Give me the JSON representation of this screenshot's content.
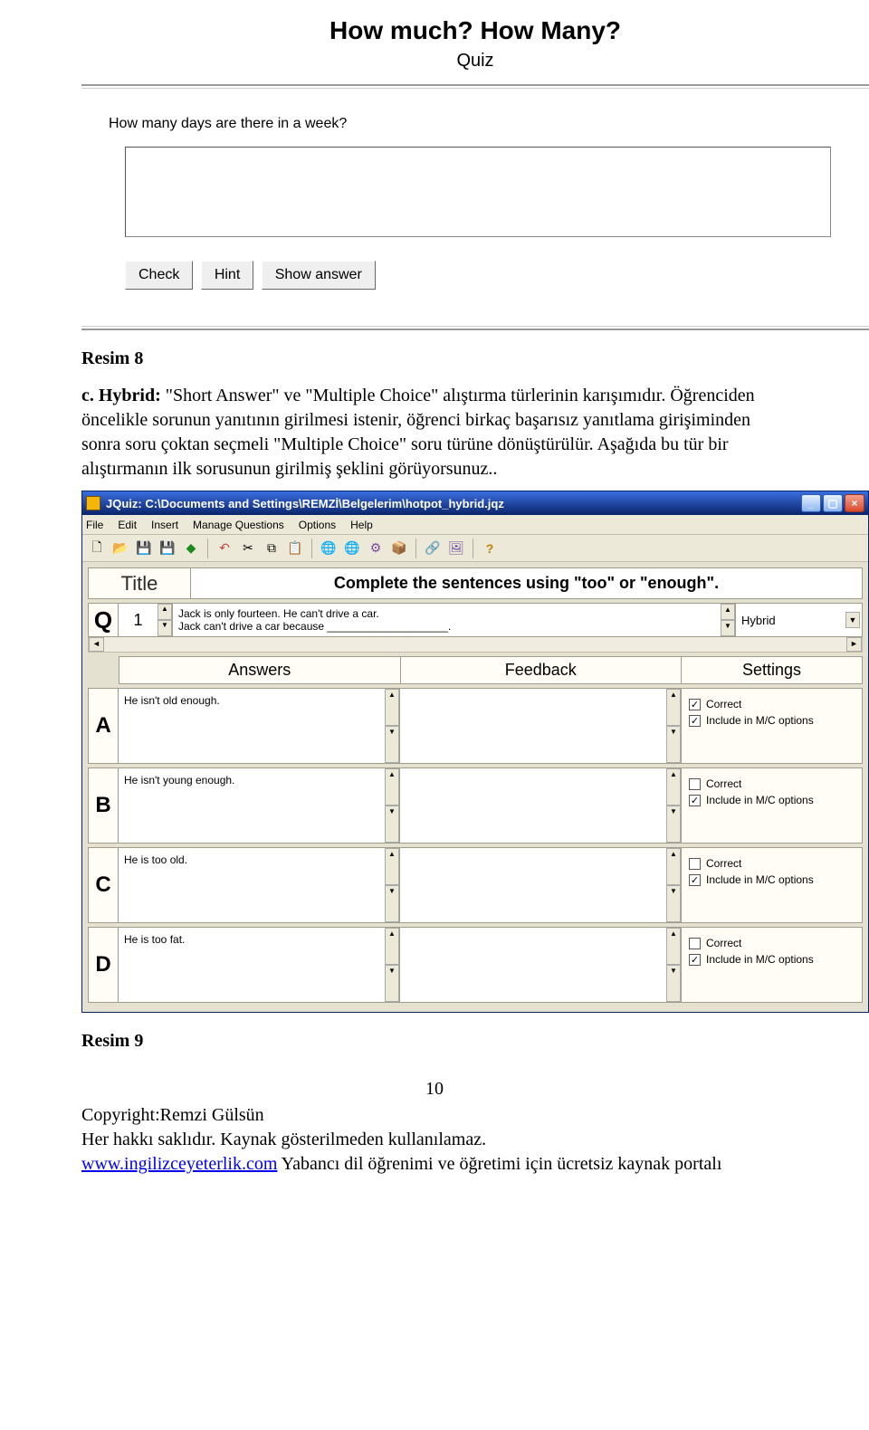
{
  "quiz": {
    "title": "How much? How Many?",
    "subtitle": "Quiz",
    "question": "How many days are there in a week?",
    "buttons": {
      "check": "Check",
      "hint": "Hint",
      "show": "Show answer"
    }
  },
  "doc": {
    "caption8": "Resim 8",
    "hybrid_label": "c. Hybrid:",
    "hybrid_text": "\"Short Answer\" ve \"Multiple Choice\" alıştırma türlerinin karışımıdır. Öğrenciden öncelikle sorunun yanıtının girilmesi istenir, öğrenci birkaç başarısız yanıtlama girişiminden sonra soru çoktan seçmeli \"Multiple Choice\" soru türüne dönüştürülür. Aşağıda bu tür bir alıştırmanın ilk sorusunun girilmiş şeklini görüyorsunuz..",
    "caption9": "Resim 9"
  },
  "jquiz": {
    "window_title": "JQuiz: C:\\Documents and Settings\\REMZİ\\Belgelerim\\hotpot_hybrid.jqz",
    "menus": [
      "File",
      "Edit",
      "Insert",
      "Manage Questions",
      "Options",
      "Help"
    ],
    "title_label": "Title",
    "title_value": "Complete the sentences using \"too\" or \"enough\".",
    "q_label": "Q",
    "q_number": "1",
    "q_text_line1": "Jack is only fourteen. He can't drive a car.",
    "q_text_line2": "Jack can't drive a car because ____________________.",
    "q_type": "Hybrid",
    "headers": {
      "answers": "Answers",
      "feedback": "Feedback",
      "settings": "Settings"
    },
    "settings_labels": {
      "correct": "Correct",
      "include": "Include in M/C options"
    },
    "answers": [
      {
        "letter": "A",
        "text": "He isn't old enough.",
        "correct": true,
        "include": true
      },
      {
        "letter": "B",
        "text": "He isn't young enough.",
        "correct": false,
        "include": true
      },
      {
        "letter": "C",
        "text": "He is too old.",
        "correct": false,
        "include": true
      },
      {
        "letter": "D",
        "text": "He is too fat.",
        "correct": false,
        "include": true
      }
    ]
  },
  "footer": {
    "page": "10",
    "line1": "Copyright:Remzi Gülsün",
    "line2": "Her hakkı saklıdır. Kaynak gösterilmeden kullanılamaz.",
    "link": "www.ingilizceyeterlik.com",
    "line3_rest": "   Yabancı dil öğrenimi ve öğretimi için ücretsiz kaynak portalı"
  }
}
